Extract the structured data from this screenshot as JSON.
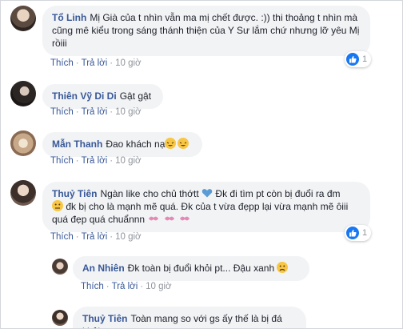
{
  "comments": [
    {
      "author": "Tổ Linh",
      "text": "Mị Già của t nhìn vẫn ma mị chết được. :)) thi thoảng t nhìn mà cũng mê kiểu trong sáng thánh thiện của Y Sư lắm chứ nhưng lỡ yêu Mị rồiii",
      "reaction_count": "1",
      "like_label": "Thích",
      "reply_label": "Trả lời",
      "time": "10 giờ"
    },
    {
      "author": "Thiên Vỹ Di Di",
      "text": "Gật gật",
      "like_label": "Thích",
      "reply_label": "Trả lời",
      "time": "10 giờ"
    },
    {
      "author": "Mẫn Thanh",
      "text": "Đao khách nạ",
      "like_label": "Thích",
      "reply_label": "Trả lời",
      "time": "10 giờ"
    },
    {
      "author": "Thuỷ Tiên",
      "text_part1": "Ngàn like cho chủ thớtt",
      "text_part2": "Đk đi tìm pt còn bị đuổi ra đm",
      "text_part3": "đk bị cho là mạnh mẽ quá. Đk của t vừa đẹpp lại vừa mạnh mẽ ôiii quá đẹp quá chuẩnnn",
      "reaction_count": "1",
      "like_label": "Thích",
      "reply_label": "Trả lời",
      "time": "10 giờ"
    }
  ],
  "replies": [
    {
      "author": "An Nhiên",
      "text": "Đk toàn bị đuổi khỏi pt... Đậu xanh",
      "like_label": "Thích",
      "reply_label": "Trả lời",
      "time": "10 giờ"
    },
    {
      "author": "Thuỷ Tiên",
      "text": "Toàn mang so với gs ấy thế là bị đá khỏi pt"
    }
  ],
  "separator": "·",
  "colors": {
    "link": "#385898",
    "bubble": "#f2f3f5",
    "like_blue": "#1877f2",
    "heart_blue": "#5b9bd5",
    "kiss_pink": "#e58ab6"
  }
}
